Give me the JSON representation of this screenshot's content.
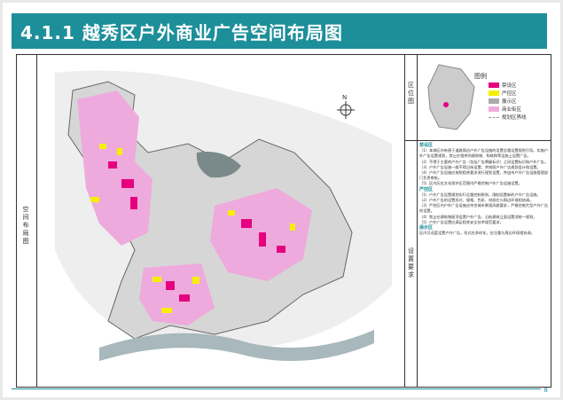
{
  "header": {
    "title": "4.1.1 越秀区户外商业广告空间布局图"
  },
  "left_label": "空间布局图",
  "location": {
    "label": "区位图",
    "legend_label": "图例"
  },
  "legend": [
    {
      "name": "禁设区",
      "color": "#e5007f"
    },
    {
      "name": "严控区",
      "color": "#f7ef00"
    },
    {
      "name": "展示区",
      "color": "#aaaaaa"
    },
    {
      "name": "商业街区",
      "color": "#eeaadd"
    },
    {
      "name": "规划区界线",
      "color": "#999999"
    }
  ],
  "requirements": {
    "label": "设置要求",
    "sections": [
      {
        "heading": "禁设区",
        "lines": [
          "（1）本城区内有限于道路周边户外广告设施的设置总量设置规划引导。实施户外广告设置规划，禁止在相关的建筑物、构筑物等设施上设置广告。",
          "（2）不得于主要的户外广告（包括广告牌匾标识）之间设置标识和户外广告。",
          "（3）户外广告设施一般不得沿街设置，并按照户外广告规划设计和设置。",
          "（4）户外广告设施应按照相关要求进行规划设置，并由市户外广告设施管理部门负责审批。",
          "（5）区内历史文化保护区范围内严格控制户外广告设施设置。"
        ]
      },
      {
        "heading": "严控区",
        "lines": [
          "（1）户外广告设置规划实行总量控制原则，限制设置新的户外广告设施。",
          "（2）户外广告的设置形式、规格、色彩、材质应与周边环境相协调。",
          "（3）严控区内户外广告设施应符合城市景观风貌要求，严格控制大型户外广告的设置。",
          "（4）禁止在建筑物屋顶设置户外广告，沿街建筑立面设置须统一规划。",
          "（5）户外广告设置应满足相关安全技术规范要求。"
        ]
      },
      {
        "heading": "展示区",
        "lines": [
          "区内可适度设置户外广告，形式应多样化，应注重与周边环境相协调。"
        ]
      }
    ]
  },
  "page_number": "8"
}
